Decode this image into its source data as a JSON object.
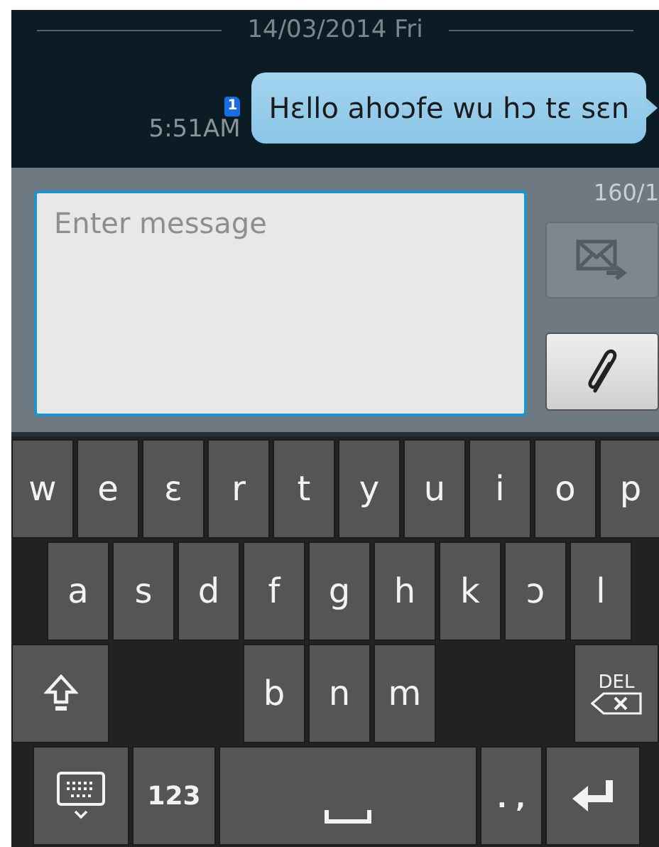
{
  "date_header": "14/03/2014 Fri",
  "message": {
    "text": "Hɛllo ahoɔfe wu hɔ tɛ sɛn",
    "time": "5:51AM",
    "sim_badge": "1"
  },
  "composer": {
    "placeholder": "Enter message",
    "counter": "160/1",
    "send_disabled": true
  },
  "keyboard": {
    "rows": [
      [
        {
          "kind": "char",
          "label": "w"
        },
        {
          "kind": "char",
          "label": "e"
        },
        {
          "kind": "char",
          "label": "ɛ"
        },
        {
          "kind": "char",
          "label": "r"
        },
        {
          "kind": "char",
          "label": "t"
        },
        {
          "kind": "char",
          "label": "y"
        },
        {
          "kind": "char",
          "label": "u"
        },
        {
          "kind": "char",
          "label": "i"
        },
        {
          "kind": "char",
          "label": "o"
        },
        {
          "kind": "char",
          "label": "p"
        }
      ],
      [
        {
          "kind": "char",
          "label": "a"
        },
        {
          "kind": "char",
          "label": "s"
        },
        {
          "kind": "char",
          "label": "d"
        },
        {
          "kind": "char",
          "label": "f"
        },
        {
          "kind": "char",
          "label": "g"
        },
        {
          "kind": "char",
          "label": "h"
        },
        {
          "kind": "char",
          "label": "k"
        },
        {
          "kind": "char",
          "label": "ɔ"
        },
        {
          "kind": "char",
          "label": "l"
        }
      ],
      [
        {
          "kind": "shift"
        },
        {
          "kind": "gap"
        },
        {
          "kind": "gap"
        },
        {
          "kind": "char",
          "label": "b"
        },
        {
          "kind": "char",
          "label": "n"
        },
        {
          "kind": "char",
          "label": "m"
        },
        {
          "kind": "gap"
        },
        {
          "kind": "gap"
        },
        {
          "kind": "gap"
        },
        {
          "kind": "delete",
          "label": "DEL"
        }
      ],
      [
        {
          "kind": "layout"
        },
        {
          "kind": "symbols",
          "label": "123"
        },
        {
          "kind": "space"
        },
        {
          "kind": "punct",
          "label": ". ,"
        },
        {
          "kind": "enter"
        }
      ]
    ]
  }
}
